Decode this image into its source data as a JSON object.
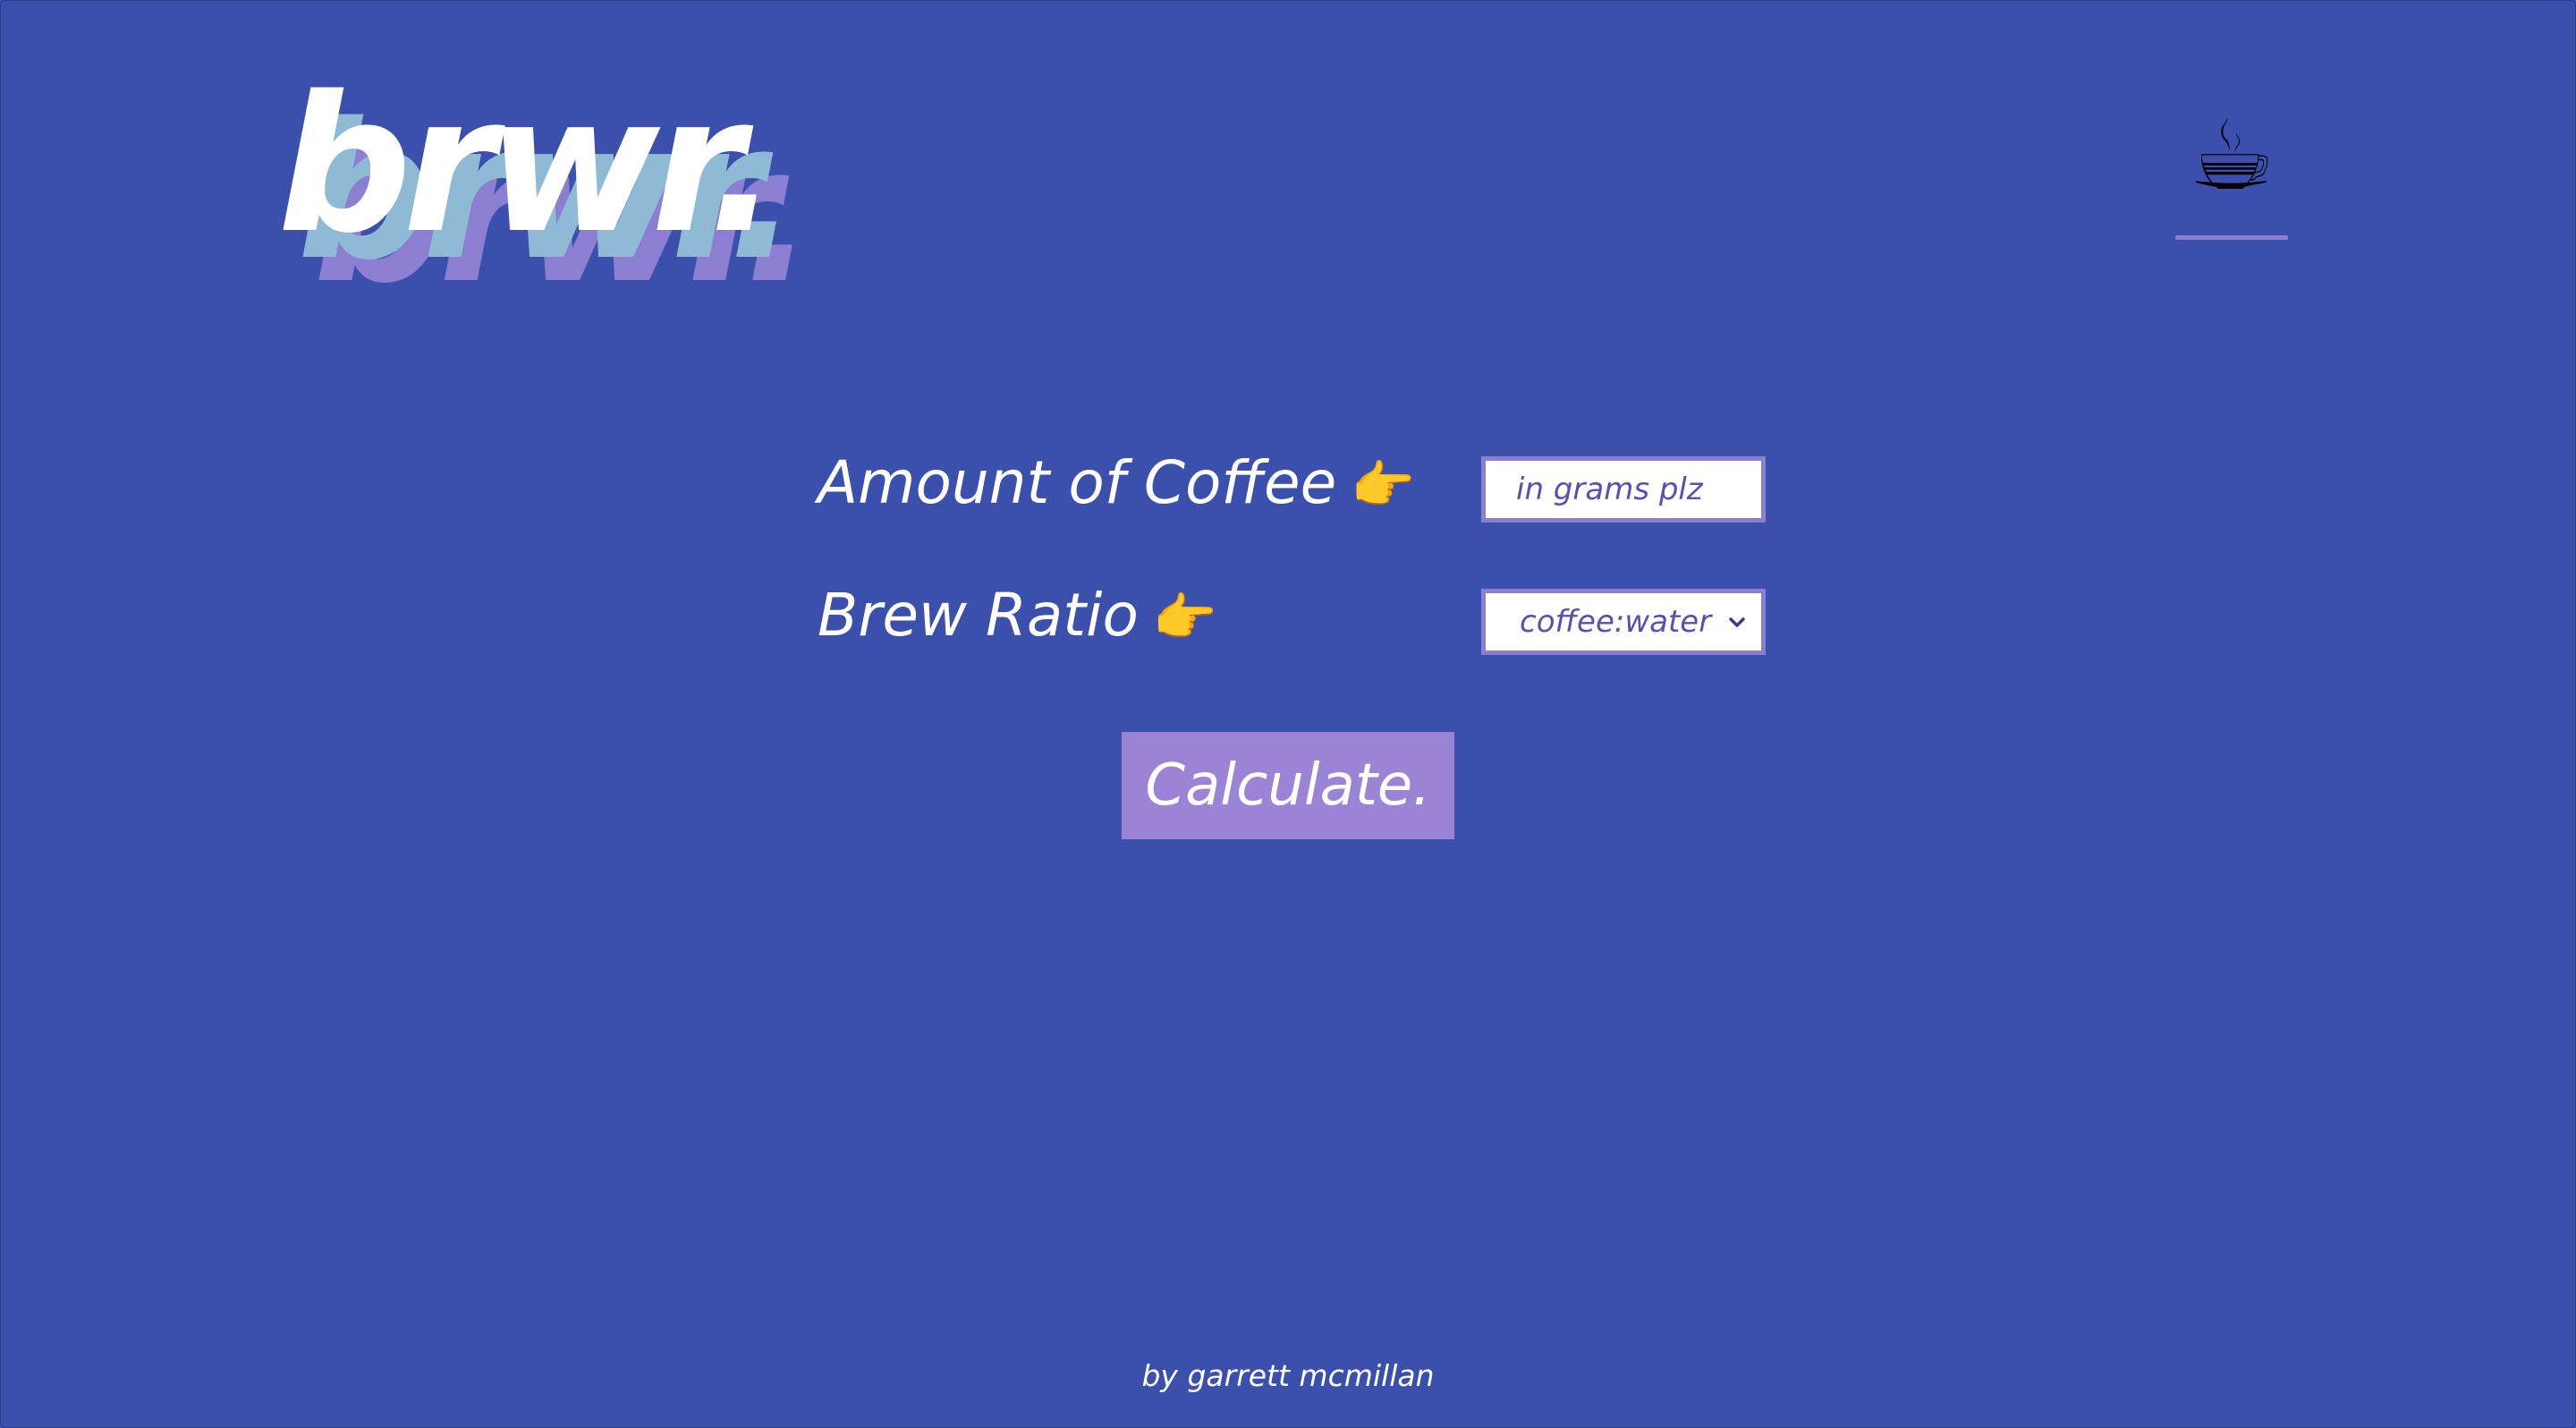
{
  "brand": {
    "logo_text": "brwr."
  },
  "nav": {
    "coffee_icon": "☕",
    "accent_color": "#8c7fd2"
  },
  "form": {
    "amount_label": "Amount of Coffee",
    "amount_pointer": "👉",
    "amount_placeholder": "in grams plz",
    "ratio_label": "Brew Ratio",
    "ratio_pointer": "👉",
    "ratio_selected": "coffee:water",
    "calculate_label": "Calculate."
  },
  "footer": {
    "credit": "by garrett mcmillan"
  },
  "colors": {
    "background": "#3b50ad",
    "button": "#9b84d6",
    "logo_shadow_blue": "#8fbad4",
    "logo_shadow_purple": "#8c7fd2"
  }
}
